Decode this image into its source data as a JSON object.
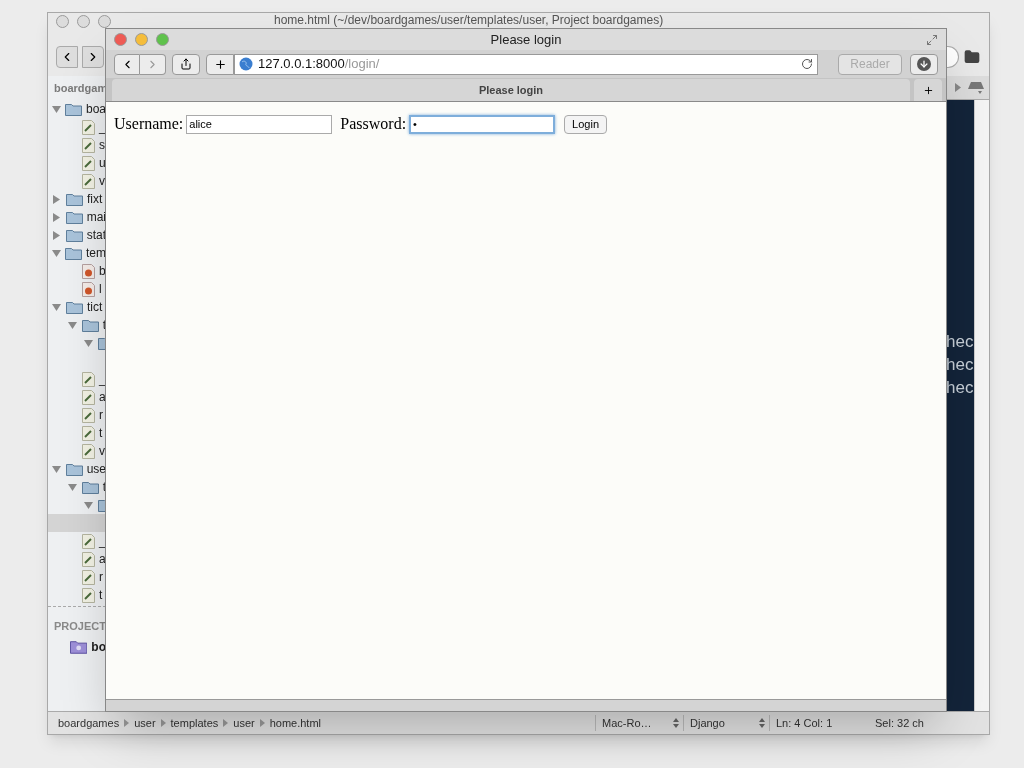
{
  "editor": {
    "title": "home.html (~/dev/boardgames/user/templates/user, Project boardgames)",
    "project_header": "boardgam",
    "tree": [
      {
        "label": "boa",
        "kind": "folder",
        "expanded": true,
        "selected": false,
        "children": [
          {
            "label": "_",
            "kind": "python",
            "selected": false
          },
          {
            "label": "s",
            "kind": "python",
            "selected": false
          },
          {
            "label": "u",
            "kind": "python",
            "selected": false
          },
          {
            "label": "v",
            "kind": "python",
            "selected": false
          }
        ]
      },
      {
        "label": "fixt",
        "kind": "folder",
        "expanded": false,
        "selected": false
      },
      {
        "label": "mai",
        "kind": "folder",
        "expanded": false,
        "selected": false
      },
      {
        "label": "stat",
        "kind": "folder",
        "expanded": false,
        "selected": false
      },
      {
        "label": "tem",
        "kind": "folder",
        "expanded": true,
        "selected": false,
        "children": [
          {
            "label": "b",
            "kind": "html",
            "selected": false
          },
          {
            "label": "l",
            "kind": "html",
            "selected": false
          }
        ]
      },
      {
        "label": "tict",
        "kind": "folder",
        "expanded": true,
        "selected": false,
        "children": [
          {
            "label": "t",
            "kind": "folder",
            "expanded": true,
            "selected": false,
            "children": [
              {
                "kind": "folder",
                "expanded": true,
                "selected": false,
                "children": [
                  {
                    "kind": "hidden_row",
                    "selected": false
                  }
                ]
              }
            ]
          },
          {
            "label": "_",
            "kind": "python",
            "selected": false
          },
          {
            "label": "a",
            "kind": "python",
            "selected": false
          },
          {
            "label": "r",
            "kind": "python",
            "selected": false
          },
          {
            "label": "t",
            "kind": "python",
            "selected": false
          },
          {
            "label": "v",
            "kind": "python",
            "selected": false
          }
        ]
      },
      {
        "label": "use",
        "kind": "folder",
        "expanded": true,
        "selected": false,
        "children": [
          {
            "label": "t",
            "kind": "folder",
            "expanded": true,
            "selected": false,
            "children": [
              {
                "kind": "folder",
                "expanded": true,
                "selected": false,
                "children": [
                  {
                    "kind": "hidden_row",
                    "selected": true
                  }
                ]
              }
            ]
          },
          {
            "label": "_",
            "kind": "python",
            "selected": false
          },
          {
            "label": "a",
            "kind": "python",
            "selected": false
          },
          {
            "label": "r",
            "kind": "python",
            "selected": false
          },
          {
            "label": "t",
            "kind": "python",
            "selected": false
          }
        ]
      }
    ],
    "projects_header": "PROJECT",
    "projects": [
      {
        "label": "bo"
      }
    ],
    "code_lines": [
      "hec",
      "hec",
      "hec"
    ],
    "status_bar": {
      "breadcrumbs": [
        "boardgames",
        "user",
        "templates",
        "user",
        "home.html"
      ],
      "line_endings": "Mac-Ro…",
      "syntax": "Django",
      "position": "Ln: 4 Col: 1",
      "selection": "Sel: 32 ch"
    }
  },
  "browser": {
    "title": "Please login",
    "url_host": "127.0.0.1:8000",
    "url_path": "/login/",
    "reader": "Reader",
    "tabs": [
      {
        "label": "Please login",
        "selected": true
      }
    ],
    "form": {
      "username_label": "Username:",
      "username_value": "alice",
      "password_label": "Password:",
      "password_value": "•",
      "password_focused": true,
      "button": "Login"
    }
  }
}
